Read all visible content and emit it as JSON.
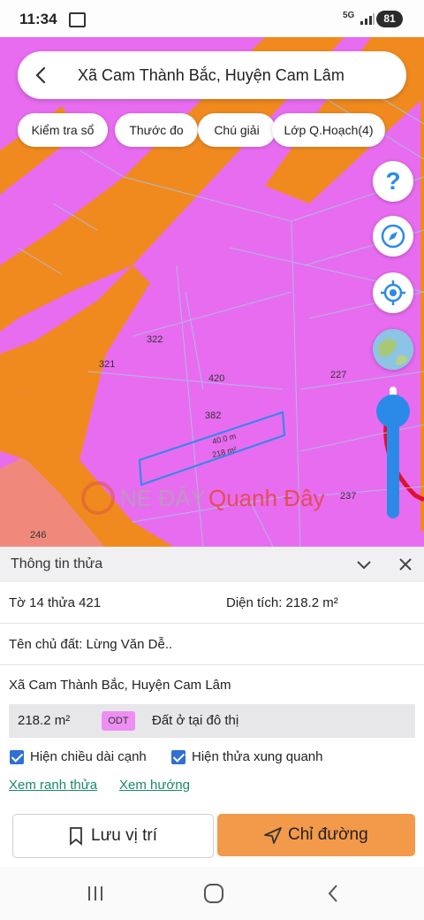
{
  "status_bar": {
    "time": "11:34",
    "network": "5G",
    "battery": "81"
  },
  "search": {
    "title": "Xã Cam Thành Bắc, Huyện Cam Lâm"
  },
  "chips": [
    "Kiểm tra sổ",
    "Thước đo",
    "Chú giải",
    "Lớp Q.Hoạch(4)"
  ],
  "map": {
    "colors": {
      "land": "#e86cf0",
      "road": "#f08a1e",
      "parcel_line": "#9fb7d8",
      "highlight": "#2b8ae8"
    },
    "parcel_numbers": [
      "322",
      "321",
      "420",
      "227",
      "382",
      "237",
      "246"
    ],
    "edge_labels": [
      "40.0 m",
      "218 m²"
    ],
    "watermark": {
      "left": "NE ĐÂY",
      "right": "Quanh Đây"
    }
  },
  "fabs": [
    "help-icon",
    "compass-icon",
    "locate-icon",
    "globe-icon"
  ],
  "panel": {
    "title": "Thông tin thửa",
    "sheet_parcel": "Tờ 14 thửa 421",
    "area_label": "Diện tích: 218.2 m²",
    "owner": "Tên chủ đất: Lừng Văn Dễ..",
    "address": "Xã Cam Thành Bắc, Huyện Cam Lâm",
    "land_area": "218.2 m²",
    "land_code": "ODT",
    "land_type": "Đất ở tại đô thị",
    "checkbox_edge": "Hiện chiều dài cạnh",
    "checkbox_neighbors": "Hiện thửa xung quanh",
    "link_boundary": "Xem ranh thửa",
    "link_direction": "Xem hướng",
    "save_label": "Lưu vị trí",
    "directions_label": "Chỉ đường"
  }
}
